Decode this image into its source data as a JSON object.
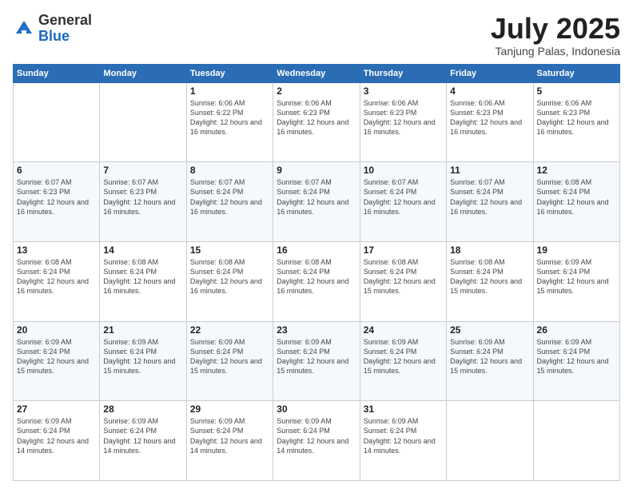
{
  "header": {
    "logo_general": "General",
    "logo_blue": "Blue",
    "month": "July 2025",
    "location": "Tanjung Palas, Indonesia"
  },
  "days_of_week": [
    "Sunday",
    "Monday",
    "Tuesday",
    "Wednesday",
    "Thursday",
    "Friday",
    "Saturday"
  ],
  "weeks": [
    [
      {
        "day": "",
        "info": ""
      },
      {
        "day": "",
        "info": ""
      },
      {
        "day": "1",
        "info": "Sunrise: 6:06 AM\nSunset: 6:22 PM\nDaylight: 12 hours and 16 minutes."
      },
      {
        "day": "2",
        "info": "Sunrise: 6:06 AM\nSunset: 6:23 PM\nDaylight: 12 hours and 16 minutes."
      },
      {
        "day": "3",
        "info": "Sunrise: 6:06 AM\nSunset: 6:23 PM\nDaylight: 12 hours and 16 minutes."
      },
      {
        "day": "4",
        "info": "Sunrise: 6:06 AM\nSunset: 6:23 PM\nDaylight: 12 hours and 16 minutes."
      },
      {
        "day": "5",
        "info": "Sunrise: 6:06 AM\nSunset: 6:23 PM\nDaylight: 12 hours and 16 minutes."
      }
    ],
    [
      {
        "day": "6",
        "info": "Sunrise: 6:07 AM\nSunset: 6:23 PM\nDaylight: 12 hours and 16 minutes."
      },
      {
        "day": "7",
        "info": "Sunrise: 6:07 AM\nSunset: 6:23 PM\nDaylight: 12 hours and 16 minutes."
      },
      {
        "day": "8",
        "info": "Sunrise: 6:07 AM\nSunset: 6:24 PM\nDaylight: 12 hours and 16 minutes."
      },
      {
        "day": "9",
        "info": "Sunrise: 6:07 AM\nSunset: 6:24 PM\nDaylight: 12 hours and 16 minutes."
      },
      {
        "day": "10",
        "info": "Sunrise: 6:07 AM\nSunset: 6:24 PM\nDaylight: 12 hours and 16 minutes."
      },
      {
        "day": "11",
        "info": "Sunrise: 6:07 AM\nSunset: 6:24 PM\nDaylight: 12 hours and 16 minutes."
      },
      {
        "day": "12",
        "info": "Sunrise: 6:08 AM\nSunset: 6:24 PM\nDaylight: 12 hours and 16 minutes."
      }
    ],
    [
      {
        "day": "13",
        "info": "Sunrise: 6:08 AM\nSunset: 6:24 PM\nDaylight: 12 hours and 16 minutes."
      },
      {
        "day": "14",
        "info": "Sunrise: 6:08 AM\nSunset: 6:24 PM\nDaylight: 12 hours and 16 minutes."
      },
      {
        "day": "15",
        "info": "Sunrise: 6:08 AM\nSunset: 6:24 PM\nDaylight: 12 hours and 16 minutes."
      },
      {
        "day": "16",
        "info": "Sunrise: 6:08 AM\nSunset: 6:24 PM\nDaylight: 12 hours and 16 minutes."
      },
      {
        "day": "17",
        "info": "Sunrise: 6:08 AM\nSunset: 6:24 PM\nDaylight: 12 hours and 15 minutes."
      },
      {
        "day": "18",
        "info": "Sunrise: 6:08 AM\nSunset: 6:24 PM\nDaylight: 12 hours and 15 minutes."
      },
      {
        "day": "19",
        "info": "Sunrise: 6:09 AM\nSunset: 6:24 PM\nDaylight: 12 hours and 15 minutes."
      }
    ],
    [
      {
        "day": "20",
        "info": "Sunrise: 6:09 AM\nSunset: 6:24 PM\nDaylight: 12 hours and 15 minutes."
      },
      {
        "day": "21",
        "info": "Sunrise: 6:09 AM\nSunset: 6:24 PM\nDaylight: 12 hours and 15 minutes."
      },
      {
        "day": "22",
        "info": "Sunrise: 6:09 AM\nSunset: 6:24 PM\nDaylight: 12 hours and 15 minutes."
      },
      {
        "day": "23",
        "info": "Sunrise: 6:09 AM\nSunset: 6:24 PM\nDaylight: 12 hours and 15 minutes."
      },
      {
        "day": "24",
        "info": "Sunrise: 6:09 AM\nSunset: 6:24 PM\nDaylight: 12 hours and 15 minutes."
      },
      {
        "day": "25",
        "info": "Sunrise: 6:09 AM\nSunset: 6:24 PM\nDaylight: 12 hours and 15 minutes."
      },
      {
        "day": "26",
        "info": "Sunrise: 6:09 AM\nSunset: 6:24 PM\nDaylight: 12 hours and 15 minutes."
      }
    ],
    [
      {
        "day": "27",
        "info": "Sunrise: 6:09 AM\nSunset: 6:24 PM\nDaylight: 12 hours and 14 minutes."
      },
      {
        "day": "28",
        "info": "Sunrise: 6:09 AM\nSunset: 6:24 PM\nDaylight: 12 hours and 14 minutes."
      },
      {
        "day": "29",
        "info": "Sunrise: 6:09 AM\nSunset: 6:24 PM\nDaylight: 12 hours and 14 minutes."
      },
      {
        "day": "30",
        "info": "Sunrise: 6:09 AM\nSunset: 6:24 PM\nDaylight: 12 hours and 14 minutes."
      },
      {
        "day": "31",
        "info": "Sunrise: 6:09 AM\nSunset: 6:24 PM\nDaylight: 12 hours and 14 minutes."
      },
      {
        "day": "",
        "info": ""
      },
      {
        "day": "",
        "info": ""
      }
    ]
  ]
}
